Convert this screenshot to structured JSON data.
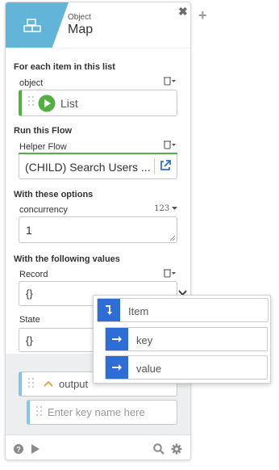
{
  "header": {
    "subtitle": "Object",
    "title": "Map",
    "close_glyph": "✖",
    "add_glyph": "+"
  },
  "sections": {
    "list": {
      "title": "For each item in this list",
      "field_label": "object",
      "value": "List"
    },
    "flow": {
      "title": "Run this Flow",
      "field_label": "Helper Flow",
      "value": "(CHILD) Search Users ..."
    },
    "options": {
      "title": "With these options",
      "field_label": "concurrency",
      "type_label": "123",
      "value": "1"
    },
    "values": {
      "title": "With the following values",
      "record_label": "Record",
      "record_value": "{}",
      "state_label": "State",
      "state_value": "{}"
    }
  },
  "output": {
    "label": "output",
    "placeholder": "Enter key name here"
  },
  "popup": {
    "items": [
      {
        "label": "Item",
        "icon": "arrow-down-icon"
      },
      {
        "label": "key",
        "icon": "arrow-right-icon"
      },
      {
        "label": "value",
        "icon": "arrow-right-icon"
      }
    ]
  },
  "colors": {
    "header_accent": "#62b5d9",
    "list_accent": "#52b043",
    "flow_accent": "#52b043",
    "popup_icon": "#2e6dd6",
    "output_accent": "#86c5e6"
  },
  "icons": [
    "object-icon",
    "close-icon",
    "add-icon",
    "trash-icon",
    "chevron-down-icon",
    "play-icon",
    "external-link-icon",
    "help-icon",
    "search-icon",
    "gear-icon",
    "resize-handle-icon"
  ]
}
